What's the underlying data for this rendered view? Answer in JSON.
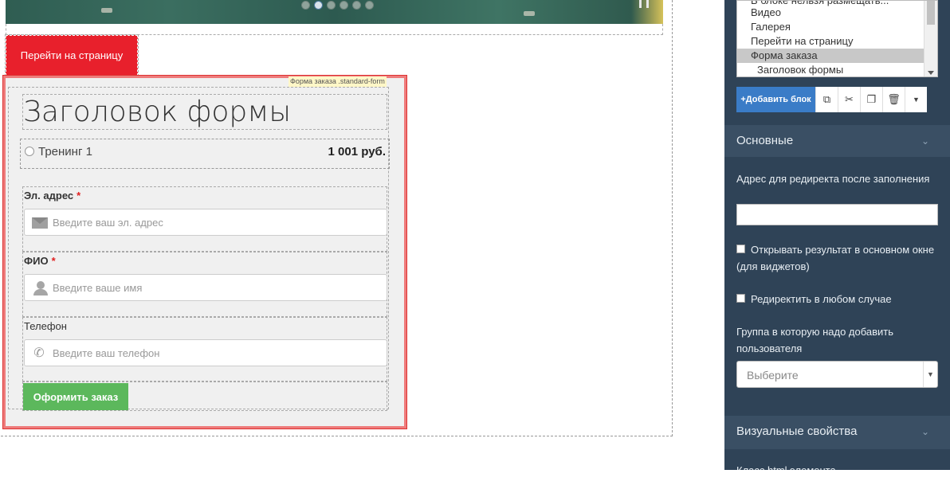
{
  "canvas": {
    "hero": {
      "slider_dot_count": 6,
      "active_dot": 1
    },
    "goto_button": {
      "label": "Перейти на страницу"
    },
    "form": {
      "tag": "Форма заказа .standard-form",
      "title": "Заголовок формы",
      "product": {
        "name": "Тренинг 1",
        "price": "1 001 руб."
      },
      "fields": [
        {
          "label": "Эл. адрес",
          "required": "*",
          "placeholder": "Введите ваш эл. адрес",
          "icon": "envelope-icon"
        },
        {
          "label": "ФИО",
          "required": "*",
          "placeholder": "Введите ваше имя",
          "icon": "user-icon"
        },
        {
          "label": "Телефон",
          "required": "",
          "placeholder": "Введите ваш телефон",
          "icon": "phone-icon"
        }
      ],
      "submit_label": "Оформить заказ"
    }
  },
  "panel": {
    "tree": {
      "items": [
        {
          "label": "В блоке нельзя размещать..."
        },
        {
          "label": "Видео"
        },
        {
          "label": "Галерея"
        },
        {
          "label": "Перейти на страницу"
        },
        {
          "label": "Форма заказа"
        },
        {
          "label": "Заголовок формы"
        }
      ]
    },
    "toolbar": {
      "add_label": "+Добавить блок",
      "icons": [
        "copy-icon",
        "scissors-icon",
        "paste-icon",
        "trash-icon",
        "dropdown-caret-icon"
      ]
    },
    "sections": {
      "basic": {
        "title": "Основные",
        "redirect_label": "Адрес для редиректа после заполнения",
        "open_result_label": "Открывать результат в основном окне (для виджетов)",
        "always_redirect_label": "Редиректить в любом случае",
        "group_label": "Группа в которую надо добавить пользователя",
        "group_select_placeholder": "Выберите"
      },
      "visual": {
        "title": "Визуальные свойства",
        "class_label": "Класс html элемента"
      }
    }
  },
  "colors": {
    "primary_red": "#e8202c",
    "accent_green": "#5cb85c",
    "panel_bg": "#2f4357",
    "accent_blue": "#3a7cc7"
  }
}
